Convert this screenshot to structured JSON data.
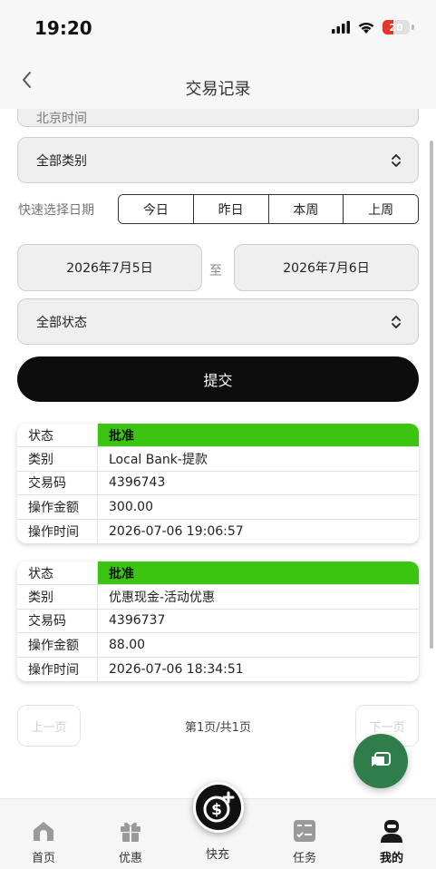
{
  "status_bar": {
    "time": "19:20",
    "battery": "20"
  },
  "nav": {
    "title": "交易记录"
  },
  "filters": {
    "timezone_partial": "北京时间",
    "category": "全部类别",
    "quick_label": "快速选择日期",
    "quick_buttons": [
      "今日",
      "昨日",
      "本周",
      "上周"
    ],
    "date_from": "2026年7月5日",
    "date_sep": "至",
    "date_to": "2026年7月6日",
    "status": "全部状态",
    "submit": "提交"
  },
  "records": [
    {
      "status_key": "状态",
      "status": "批准",
      "category_key": "类别",
      "category": "Local Bank-提款",
      "code_key": "交易码",
      "code": "4396743",
      "amount_key": "操作金额",
      "amount": "300.00",
      "time_key": "操作时间",
      "time": "2026-07-06 19:06:57"
    },
    {
      "status_key": "状态",
      "status": "批准",
      "category_key": "类别",
      "category": "优惠现金-活动优惠",
      "code_key": "交易码",
      "code": "4396737",
      "amount_key": "操作金额",
      "amount": "88.00",
      "time_key": "操作时间",
      "time": "2026-07-06 18:34:51"
    }
  ],
  "pager": {
    "prev": "上一页",
    "info": "第1页/共1页",
    "next": "下一页"
  },
  "tabs": [
    {
      "label": "首页",
      "icon": "home-icon"
    },
    {
      "label": "优惠",
      "icon": "gift-icon"
    },
    {
      "label": "快充",
      "icon": "dollar-plus-icon"
    },
    {
      "label": "任务",
      "icon": "task-list-icon"
    },
    {
      "label": "我的",
      "icon": "profile-icon"
    }
  ],
  "colors": {
    "status_approved": "#3cc510",
    "fab": "#2e7d4a",
    "submit": "#0d0d0d"
  }
}
